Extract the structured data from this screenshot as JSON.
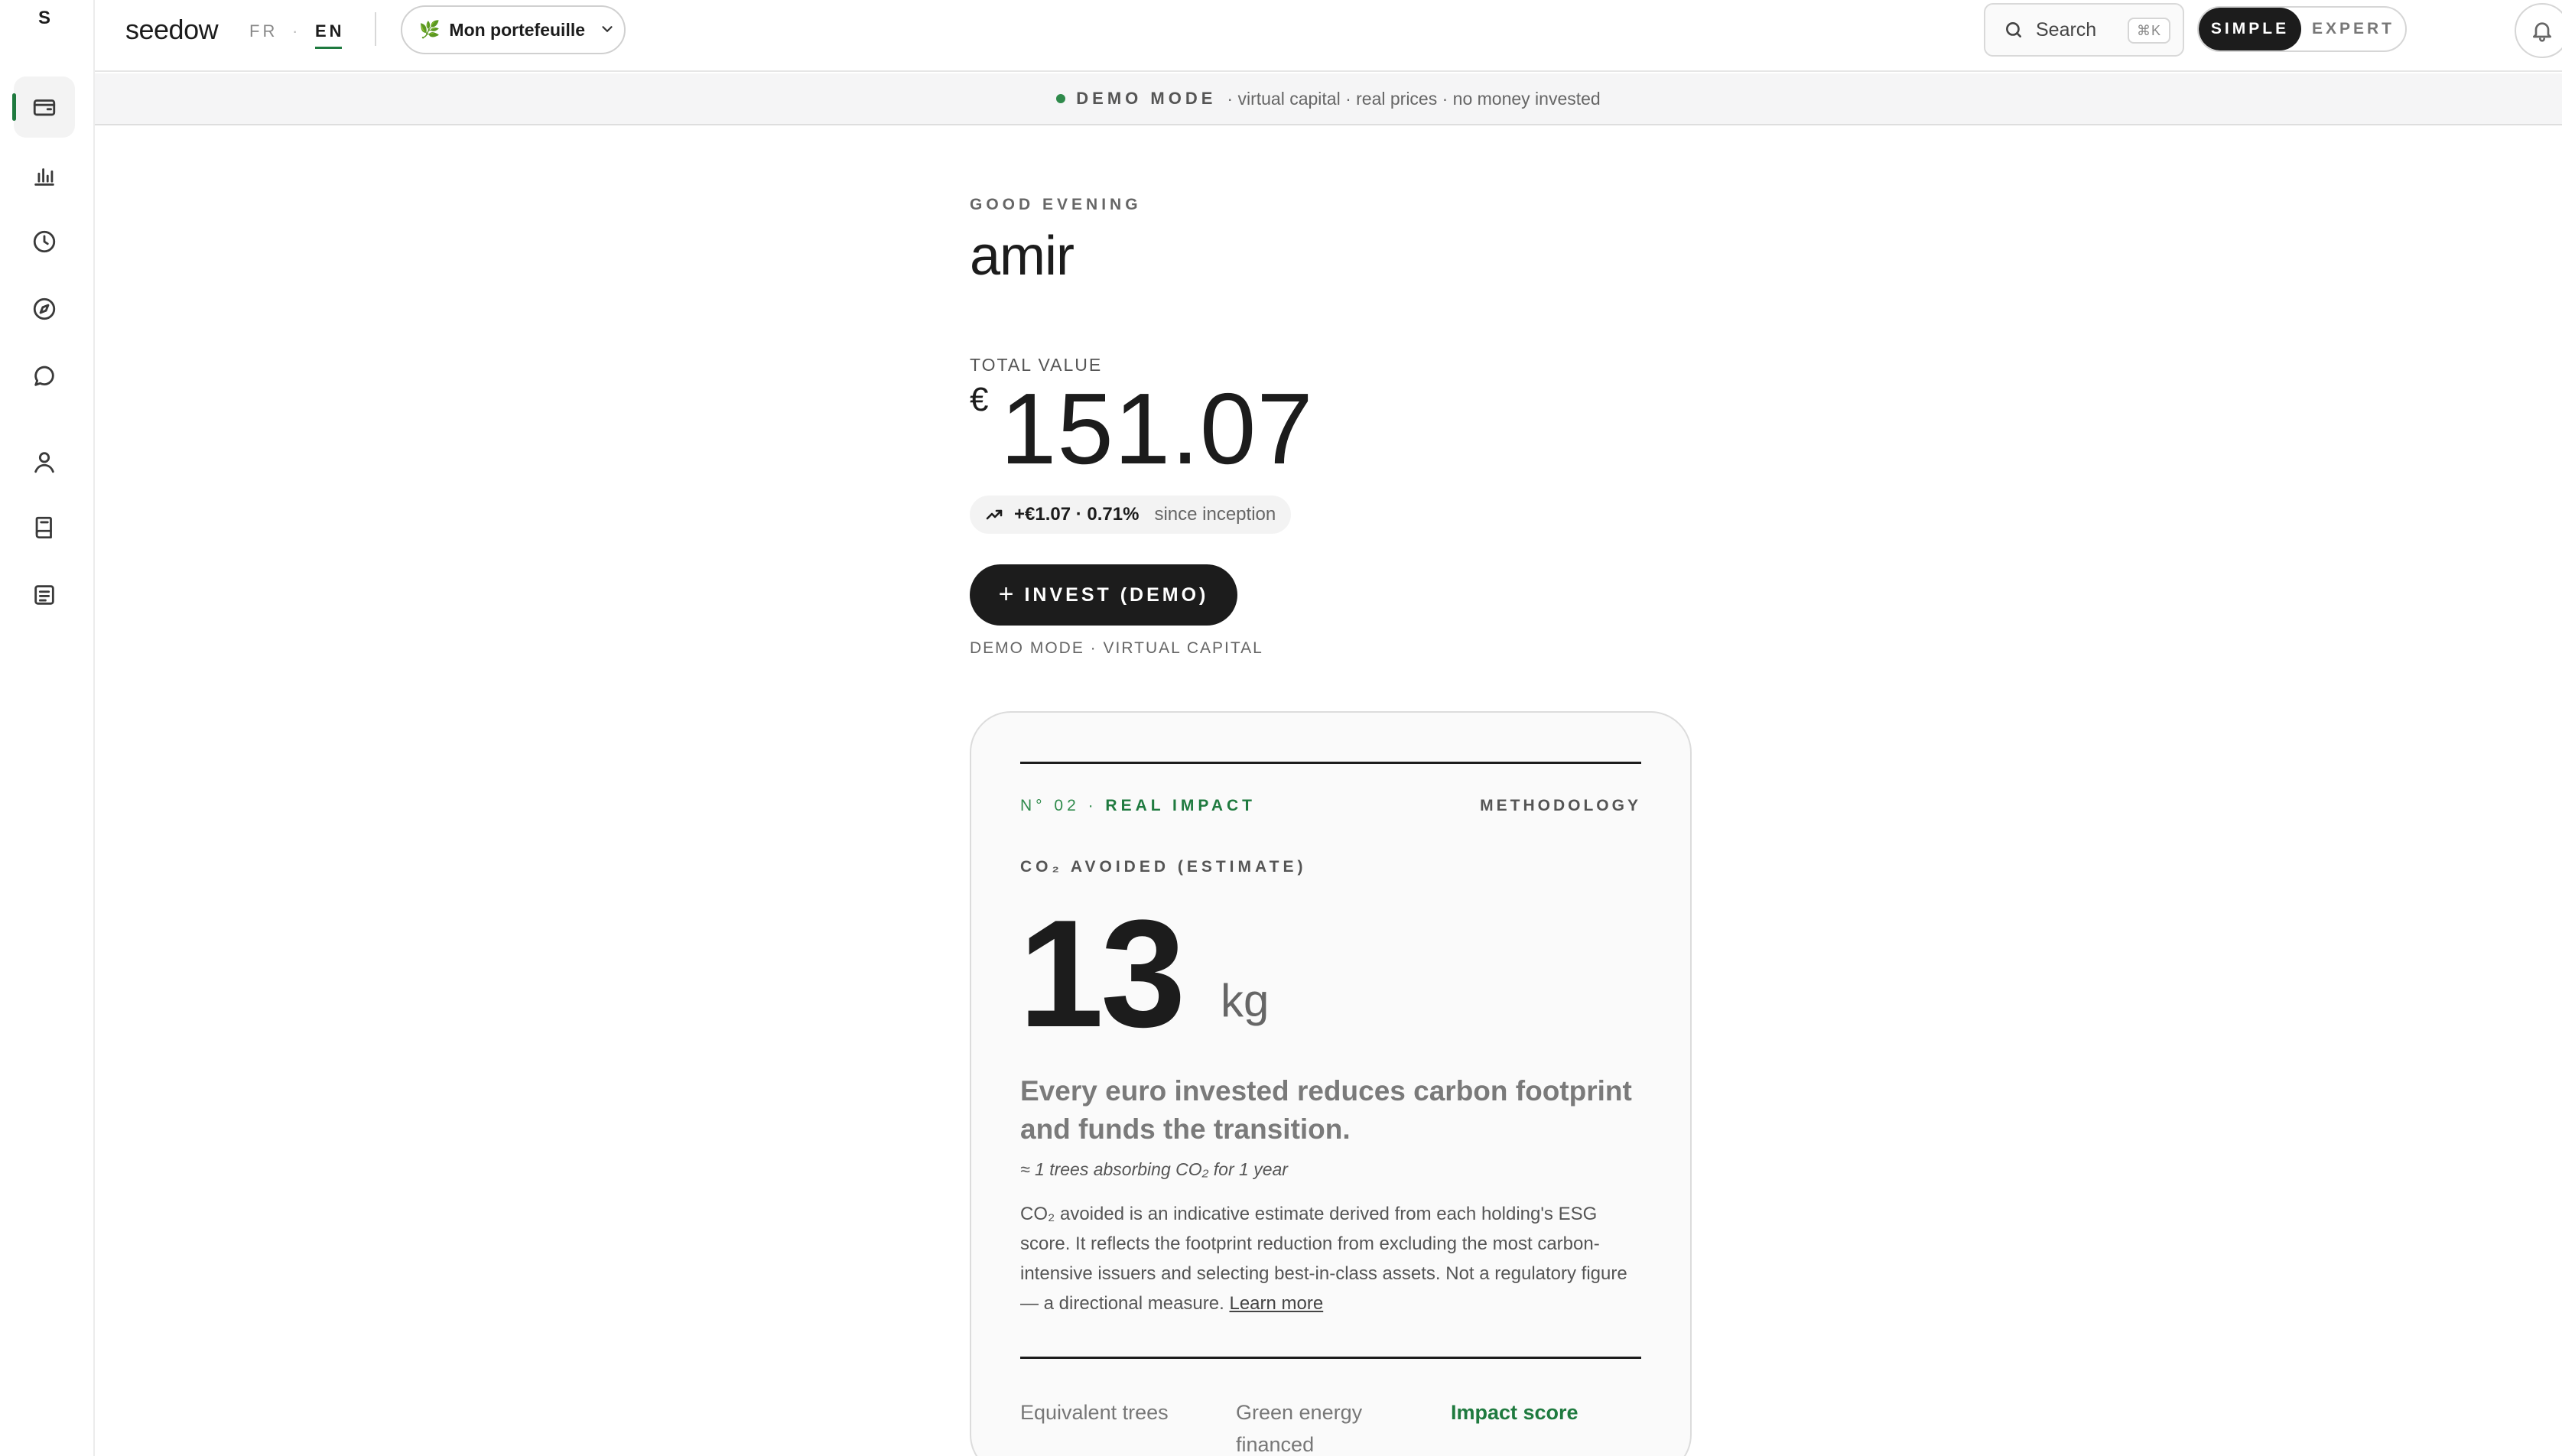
{
  "sidebar": {
    "avatar_letter": "S",
    "items": [
      {
        "name": "wallet",
        "active": true
      },
      {
        "name": "chart"
      },
      {
        "name": "history"
      },
      {
        "name": "explore"
      },
      {
        "name": "chat"
      },
      {
        "name": "profile"
      },
      {
        "name": "book"
      },
      {
        "name": "documents"
      }
    ]
  },
  "topbar": {
    "brand": "seedow",
    "lang_fr": "FR",
    "lang_sep": "·",
    "lang_en": "EN",
    "portfolio_label": "Mon portefeuille",
    "search_label": "Search",
    "search_shortcut": "⌘K",
    "mode_simple": "SIMPLE",
    "mode_expert": "EXPERT"
  },
  "banner": {
    "title": "DEMO MODE",
    "text": "· virtual capital · real prices · no money invested"
  },
  "greeting": {
    "label": "GOOD EVENING",
    "name": "amir"
  },
  "total": {
    "label": "TOTAL VALUE",
    "currency": "€",
    "value": "151.07",
    "change": "+€1.07 · 0.71%",
    "since": "since inception"
  },
  "invest": {
    "plus": "+",
    "label": "INVEST (DEMO)",
    "caption": "DEMO MODE · VIRTUAL CAPITAL"
  },
  "impact": {
    "kicker_num": "N° 02 · ",
    "kicker_title": "REAL IMPACT",
    "methodology": "METHODOLOGY",
    "co2_label": "CO₂ AVOIDED (ESTIMATE)",
    "value": "13",
    "unit": "kg",
    "headline": "Every euro invested reduces carbon footprint and funds the transition.",
    "approx": "≈ 1 trees absorbing CO₂ for 1 year",
    "description": "CO₂ avoided is an indicative estimate derived from each holding's ESG score. It reflects the footprint reduction from excluding the most carbon-intensive issuers and selecting best-in-class assets. Not a regulatory figure — a directional measure.",
    "learn_more": "Learn more",
    "stat_trees": "Equivalent trees",
    "stat_energy": "Green energy financed",
    "stat_score": "Impact score"
  }
}
